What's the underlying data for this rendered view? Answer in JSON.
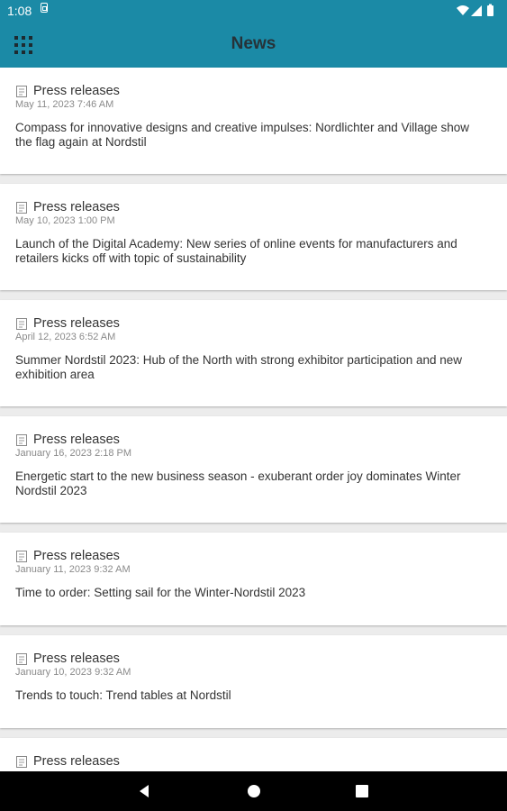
{
  "status_bar": {
    "time": "1:08"
  },
  "app_bar": {
    "title": "News",
    "menu_icon": "apps-grid-icon"
  },
  "news_items": [
    {
      "category": "Press releases",
      "date": "May 11, 2023 7:46 AM",
      "headline": "Compass for innovative designs and creative impulses: Nordlichter and Village show the flag again at Nordstil"
    },
    {
      "category": "Press releases",
      "date": "May 10, 2023 1:00 PM",
      "headline": "Launch of the Digital Academy: New series of online events for manufacturers and retailers kicks off with topic of sustainability"
    },
    {
      "category": "Press releases",
      "date": "April 12, 2023 6:52 AM",
      "headline": "Summer Nordstil 2023: Hub of the North with strong exhibitor participation and new exhibition area"
    },
    {
      "category": "Press releases",
      "date": "January 16, 2023 2:18 PM",
      "headline": "Energetic start to the new business season - exuberant order joy dominates Winter Nordstil 2023"
    },
    {
      "category": "Press releases",
      "date": "January 11, 2023 9:32 AM",
      "headline": "Time to order: Setting sail for the Winter-Nordstil 2023"
    },
    {
      "category": "Press releases",
      "date": "January 10, 2023 9:32 AM",
      "headline": "Trends to touch: Trend tables at Nordstil"
    },
    {
      "category": "Press releases",
      "date": "",
      "headline": ""
    }
  ],
  "colors": {
    "app_bar": "#1b8aa6",
    "background": "#ececec",
    "card": "#ffffff"
  }
}
